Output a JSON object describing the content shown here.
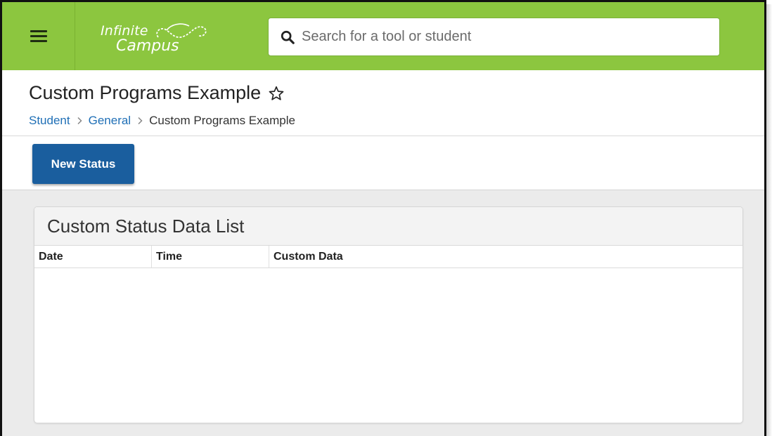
{
  "header": {
    "logo_line1": "Infinite",
    "logo_line2": "Campus",
    "search": {
      "placeholder": "Search for a tool or student",
      "value": ""
    }
  },
  "page": {
    "title": "Custom Programs Example",
    "breadcrumb": [
      "Student",
      "General",
      "Custom Programs Example"
    ]
  },
  "toolbar": {
    "new_status_label": "New Status"
  },
  "panel": {
    "title": "Custom Status Data List",
    "columns": [
      "Date",
      "Time",
      "Custom Data"
    ],
    "rows": []
  },
  "colors": {
    "header_green": "#8cc63f",
    "primary_button": "#1a5e9e",
    "link_blue": "#1f6fb6"
  },
  "icons": [
    "hamburger-menu-icon",
    "search-icon",
    "star-outline-icon",
    "chevron-right-icon"
  ]
}
